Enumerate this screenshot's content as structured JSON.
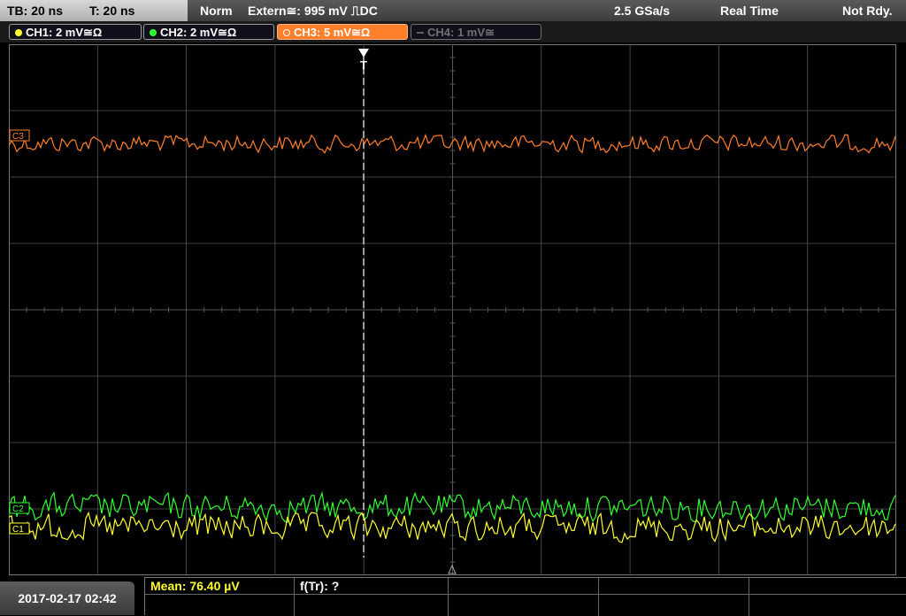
{
  "topbar": {
    "timebase": "TB: 20 ns",
    "trigger_time": "T: 20 ns",
    "mode": "Norm",
    "trigger_source": "Extern≅: 995 mV ⎍DC",
    "sample_rate": "2.5 GSa/s",
    "acq_mode": "Real Time",
    "status": "Not Rdy."
  },
  "channels": [
    {
      "label": "CH1: 2 mV≅Ω",
      "color": "#ffff30",
      "active": true
    },
    {
      "label": "CH2: 2 mV≅Ω",
      "color": "#30ff30",
      "active": true
    },
    {
      "label": "CH3: 5 mV≅Ω",
      "color": "#ff7f2a",
      "active": true,
      "selected": true
    },
    {
      "label": "CH4: 1 mV≅",
      "color": "#707070",
      "active": false
    }
  ],
  "markers": {
    "c3": "C3",
    "c2": "C2",
    "c1": "C1",
    "trigger": "T"
  },
  "footer": {
    "datetime": "2017-02-17 02:42",
    "mean": "Mean: 76.40 µV",
    "freq": "f(Tr): ?"
  },
  "colors": {
    "ch1": "#ffff30",
    "ch2": "#30ff30",
    "ch3": "#ff7f2a",
    "grid": "#555555",
    "mean_text": "#ffff30"
  }
}
